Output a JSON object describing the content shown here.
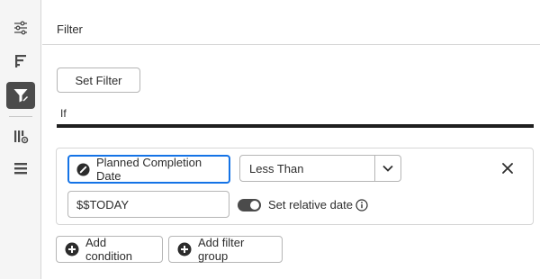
{
  "sidebar": {
    "items": [
      {
        "icon": "sliders-icon",
        "active": false
      },
      {
        "icon": "sort-bars-icon",
        "active": false
      },
      {
        "icon": "filter-icon",
        "active": true
      },
      {
        "icon": "column-settings-icon",
        "active": false
      },
      {
        "icon": "list-icon",
        "active": false
      }
    ]
  },
  "header": {
    "title": "Filter"
  },
  "set_filter_label": "Set Filter",
  "if_label": "If",
  "condition": {
    "field": "Planned Completion Date",
    "field_icon": "calendar-pill-icon",
    "operator": "Less Than",
    "value": "$$TODAY",
    "relative_date_label": "Set relative date",
    "relative_date_on": true
  },
  "actions": {
    "add_condition": "Add condition",
    "add_filter_group": "Add filter group"
  },
  "colors": {
    "accent": "#1473e6",
    "active_icon_bg": "#4b4b4b",
    "rule": "#1f1f1f"
  }
}
